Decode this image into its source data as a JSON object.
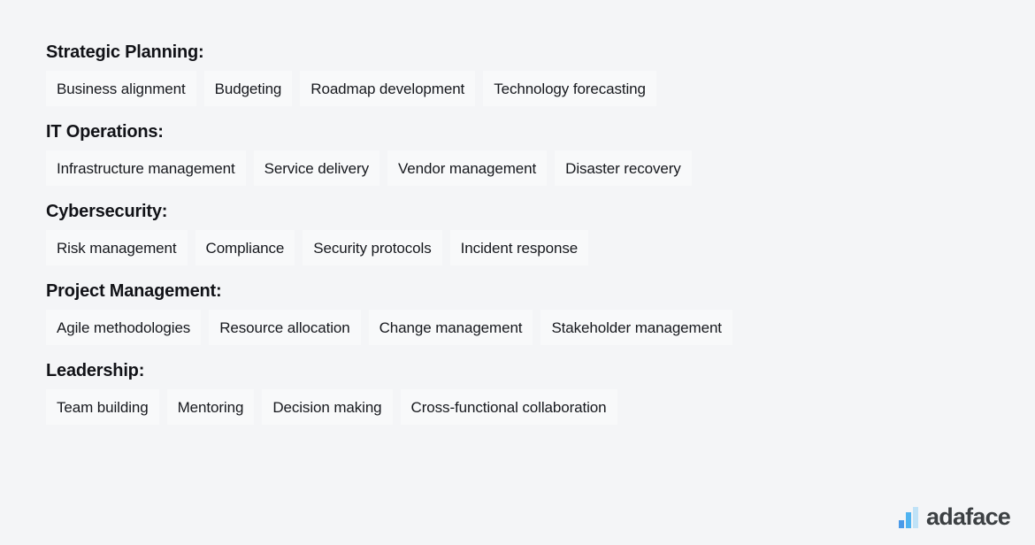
{
  "groups": [
    {
      "heading": "Strategic Planning:",
      "items": [
        "Business alignment",
        "Budgeting",
        "Roadmap development",
        "Technology forecasting"
      ]
    },
    {
      "heading": "IT Operations:",
      "items": [
        "Infrastructure management",
        "Service delivery",
        "Vendor management",
        "Disaster recovery"
      ]
    },
    {
      "heading": "Cybersecurity:",
      "items": [
        "Risk management",
        "Compliance",
        "Security protocols",
        "Incident response"
      ]
    },
    {
      "heading": "Project Management:",
      "items": [
        "Agile methodologies",
        "Resource allocation",
        "Change management",
        "Stakeholder management"
      ]
    },
    {
      "heading": "Leadership:",
      "items": [
        "Team building",
        "Mentoring",
        "Decision making",
        "Cross-functional collaboration"
      ]
    }
  ],
  "logo": {
    "icon": "bar-chart-logo-icon",
    "text": "adaface",
    "bar_colors": [
      "#4a9ae8",
      "#4fb3f0",
      "#bfe2f7"
    ],
    "text_color": "#3c4043"
  },
  "colors": {
    "page_background": "#f4f5f7",
    "chip_background": "#f8f9fa",
    "chip_border": "#5a5f6b",
    "heading_text": "#111217",
    "chip_text": "#16181d"
  }
}
